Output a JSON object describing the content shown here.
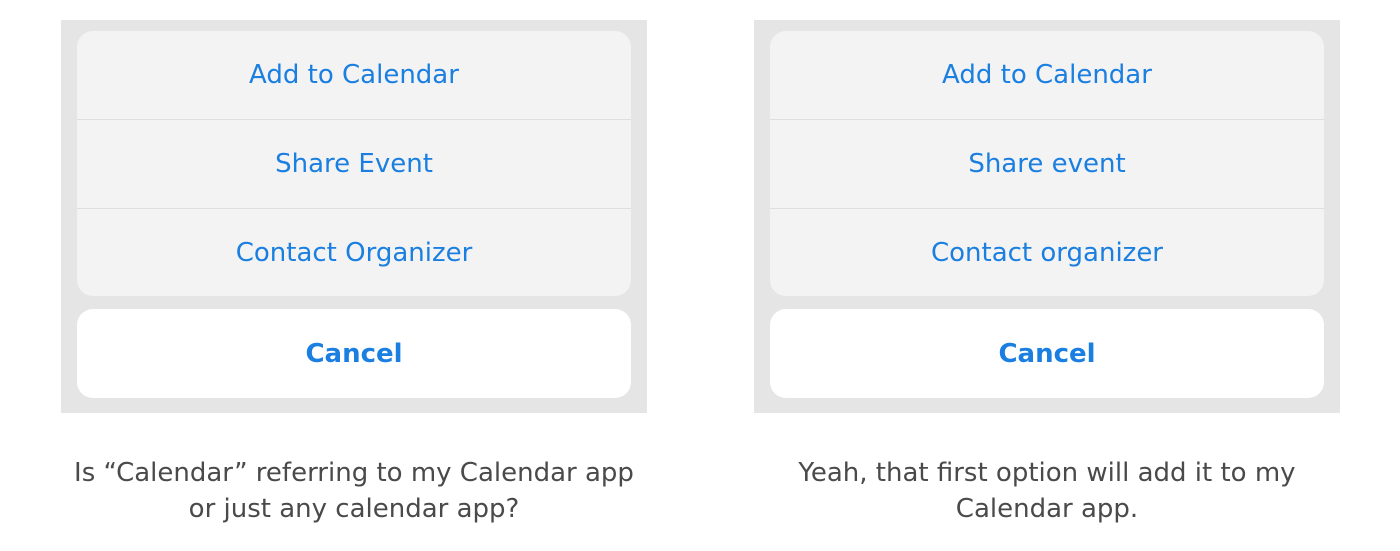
{
  "left_panel": {
    "items": [
      {
        "label": "Add to Calendar"
      },
      {
        "label": "Share Event"
      },
      {
        "label": "Contact Organizer"
      }
    ],
    "cancel_label": "Cancel",
    "caption": {
      "line1": "Is “Calendar” referring to my Calendar app",
      "line2": "or just any calendar app?"
    }
  },
  "right_panel": {
    "items": [
      {
        "label": "Add to Calendar"
      },
      {
        "label": "Share event"
      },
      {
        "label": "Contact organizer"
      }
    ],
    "cancel_label": "Cancel",
    "caption": {
      "line1": "Yeah, that first option will add it to my",
      "line2": "Calendar app."
    }
  },
  "colors": {
    "accent": "#1a7fe0",
    "panel_background": "#e5e5e5",
    "sheet_background": "#f3f3f3",
    "caption_text": "#4a4a4a"
  }
}
